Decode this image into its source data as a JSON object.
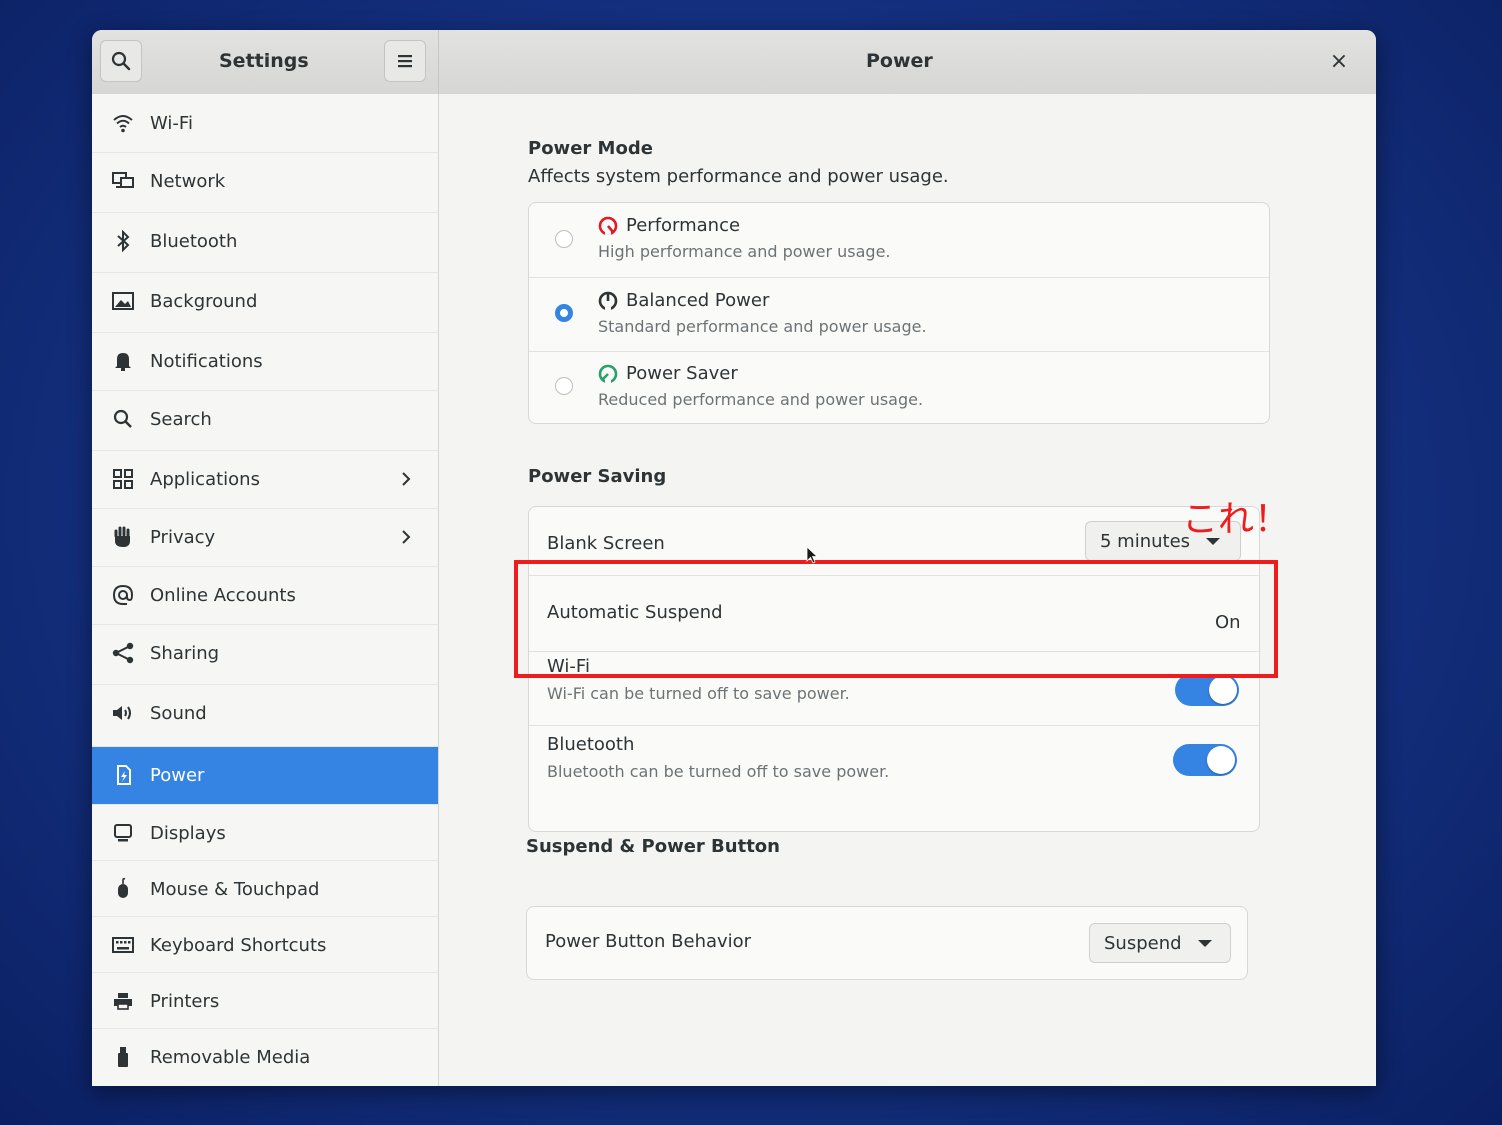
{
  "window": {
    "sidebar_title": "Settings",
    "page_title": "Power",
    "close_glyph": "×"
  },
  "sidebar": {
    "items": [
      {
        "label": "Wi-Fi",
        "icon": "wifi-icon"
      },
      {
        "label": "Network",
        "icon": "network-icon"
      },
      {
        "label": "Bluetooth",
        "icon": "bluetooth-icon"
      },
      {
        "label": "Background",
        "icon": "background-icon"
      },
      {
        "label": "Notifications",
        "icon": "bell-icon"
      },
      {
        "label": "Search",
        "icon": "search-icon"
      },
      {
        "label": "Applications",
        "icon": "grid-icon",
        "has_submenu": true
      },
      {
        "label": "Privacy",
        "icon": "hand-icon",
        "has_submenu": true
      },
      {
        "label": "Online Accounts",
        "icon": "at-icon"
      },
      {
        "label": "Sharing",
        "icon": "share-icon"
      },
      {
        "label": "Sound",
        "icon": "speaker-icon"
      },
      {
        "label": "Power",
        "icon": "power-icon",
        "active": true
      },
      {
        "label": "Displays",
        "icon": "display-icon"
      },
      {
        "label": "Mouse & Touchpad",
        "icon": "mouse-icon"
      },
      {
        "label": "Keyboard Shortcuts",
        "icon": "keyboard-icon"
      },
      {
        "label": "Printers",
        "icon": "printer-icon"
      },
      {
        "label": "Removable Media",
        "icon": "usb-icon"
      }
    ]
  },
  "power_mode": {
    "title": "Power Mode",
    "subtitle": "Affects system performance and power usage.",
    "options": [
      {
        "label": "Performance",
        "description": "High performance and power usage.",
        "selected": false,
        "icon": "performance-gauge-icon",
        "icon_color": "#e01b24"
      },
      {
        "label": "Balanced Power",
        "description": "Standard performance and power usage.",
        "selected": true,
        "icon": "balanced-gauge-icon",
        "icon_color": "#2e3436"
      },
      {
        "label": "Power Saver",
        "description": "Reduced performance and power usage.",
        "selected": false,
        "icon": "saver-gauge-icon",
        "icon_color": "#26a269"
      }
    ]
  },
  "power_saving": {
    "title": "Power Saving",
    "blank_screen": {
      "label": "Blank Screen",
      "value": "5 minutes"
    },
    "automatic_suspend": {
      "label": "Automatic Suspend",
      "value": "On"
    },
    "wifi": {
      "label": "Wi-Fi",
      "description": "Wi-Fi can be turned off to save power.",
      "enabled": true
    },
    "bluetooth": {
      "label": "Bluetooth",
      "description": "Bluetooth can be turned off to save power.",
      "enabled": true
    }
  },
  "suspend_power_button": {
    "title": "Suspend & Power Button",
    "power_button_behavior": {
      "label": "Power Button Behavior",
      "value": "Suspend"
    }
  },
  "annotation": {
    "text": "これ！",
    "color": "#ee1c1c"
  },
  "colors": {
    "accent": "#3584e4",
    "highlight": "#ee1c1c"
  }
}
